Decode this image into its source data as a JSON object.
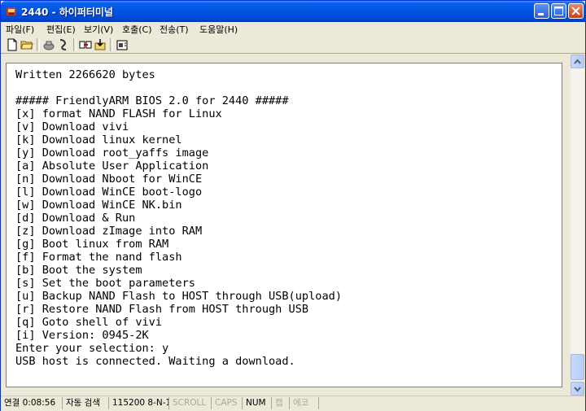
{
  "window": {
    "title": "2440 - 하이퍼터미널"
  },
  "menu": [
    {
      "label": "파일(F)"
    },
    {
      "label": "편집(E)"
    },
    {
      "label": "보기(V)"
    },
    {
      "label": "호출(C)"
    },
    {
      "label": "전송(T)"
    },
    {
      "label": "도움말(H)"
    }
  ],
  "toolbar": {
    "icons": [
      "new-document-icon",
      "open-folder-icon",
      "phone-icon",
      "disconnect-icon",
      "send-icon",
      "receive-icon",
      "properties-icon"
    ]
  },
  "terminal": {
    "lines": [
      "Written 2266620 bytes",
      "",
      "##### FriendlyARM BIOS 2.0 for 2440 #####",
      "[x] format NAND FLASH for Linux",
      "[v] Download vivi",
      "[k] Download linux kernel",
      "[y] Download root_yaffs image",
      "[a] Absolute User Application",
      "[n] Download Nboot for WinCE",
      "[l] Download WinCE boot-logo",
      "[w] Download WinCE NK.bin",
      "[d] Download & Run",
      "[z] Download zImage into RAM",
      "[g] Boot linux from RAM",
      "[f] Format the nand flash",
      "[b] Boot the system",
      "[s] Set the boot parameters",
      "[u] Backup NAND Flash to HOST through USB(upload)",
      "[r] Restore NAND Flash from HOST through USB",
      "[q] Goto shell of vivi",
      "[i] Version: 0945-2K",
      "Enter your selection: y",
      "USB host is connected. Waiting a download."
    ]
  },
  "statusbar": {
    "connected": "연결 0:08:56",
    "detect": "자동 검색",
    "settings": "115200 8-N-1",
    "scroll": "SCROLL",
    "caps": "CAPS",
    "num": "NUM",
    "capture": "캡",
    "print": "에코"
  },
  "colors": {
    "titlebar": "#0054e3",
    "terminal_bg": "#ffffff",
    "text": "#000000"
  }
}
